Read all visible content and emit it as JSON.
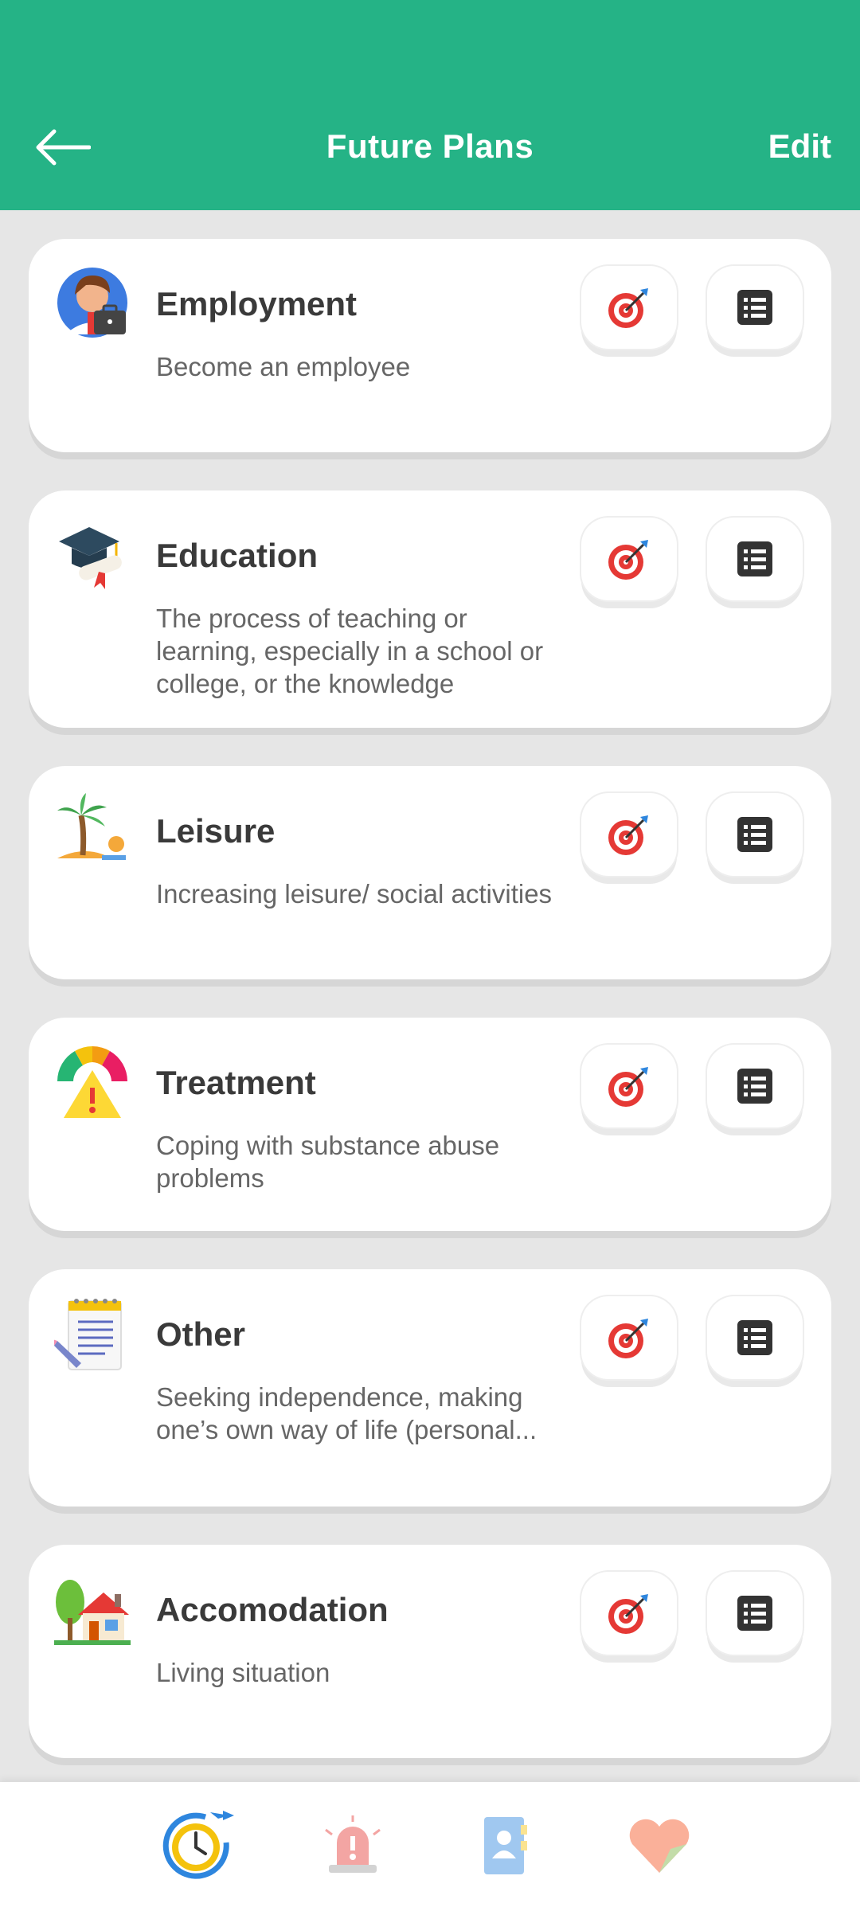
{
  "header": {
    "title": "Future Plans",
    "edit_label": "Edit"
  },
  "cards": [
    {
      "title": "Employment",
      "description": "Become an employee",
      "icon": "employee-icon"
    },
    {
      "title": "Education",
      "description": "The process of teaching or learning, especially in a school or college, or the knowledge",
      "icon": "graduation-cap-icon"
    },
    {
      "title": "Leisure",
      "description": "Increasing leisure/ social activities",
      "icon": "palm-island-icon"
    },
    {
      "title": "Treatment",
      "description": "Coping with substance abuse problems",
      "icon": "warning-gauge-icon"
    },
    {
      "title": "Other",
      "description": "Seeking independence, making one’s own way of life (personal...",
      "icon": "notepad-icon"
    },
    {
      "title": "Accomodation",
      "description": "Living situation",
      "icon": "house-icon"
    }
  ],
  "bottom_nav": [
    "clock-progress-icon",
    "alarm-siren-icon",
    "contacts-book-icon",
    "heart-icon"
  ],
  "colors": {
    "header": "#25b386",
    "target_red": "#e53935",
    "dark_icon": "#333333"
  }
}
